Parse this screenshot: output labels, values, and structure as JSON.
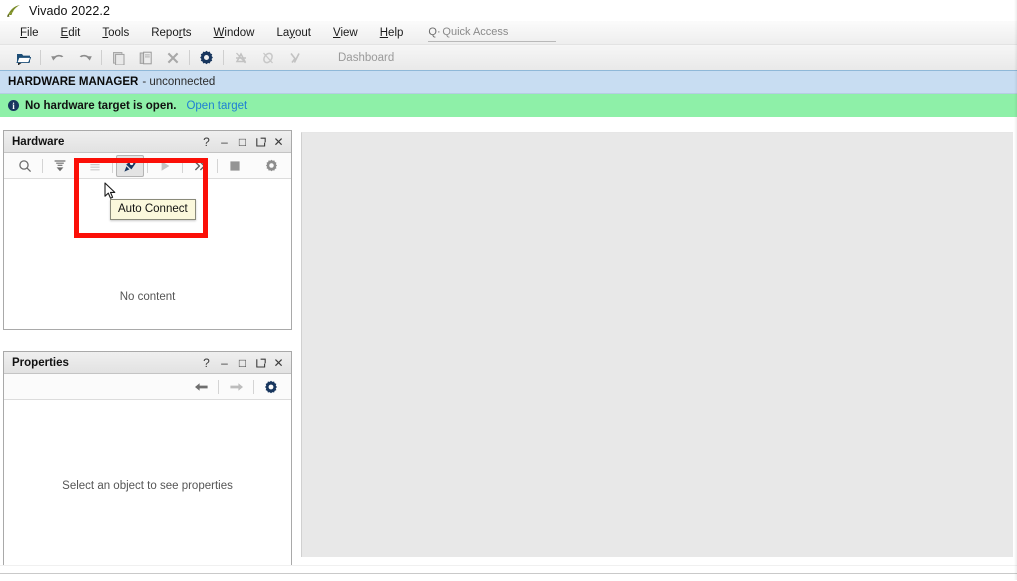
{
  "window": {
    "title": "Vivado 2022.2",
    "logo_icon": "vivado-leaf-icon"
  },
  "menubar": {
    "items": [
      {
        "label": "File",
        "mnemonic_index": 0
      },
      {
        "label": "Edit",
        "mnemonic_index": 0
      },
      {
        "label": "Tools",
        "mnemonic_index": 0
      },
      {
        "label": "Reports",
        "mnemonic_index": 4
      },
      {
        "label": "Window",
        "mnemonic_index": 0
      },
      {
        "label": "Layout",
        "mnemonic_index": 2
      },
      {
        "label": "View",
        "mnemonic_index": 0
      },
      {
        "label": "Help",
        "mnemonic_index": 0
      }
    ],
    "quick_access": {
      "prefix": "Q·",
      "placeholder": "Quick Access",
      "value": ""
    }
  },
  "toolbar": {
    "buttons": [
      {
        "name": "open-project-icon",
        "title": "Open Project",
        "enabled": true
      },
      {
        "name": "undo-icon",
        "title": "Undo",
        "enabled": true
      },
      {
        "name": "redo-icon",
        "title": "Redo",
        "enabled": true
      },
      {
        "name": "copy-icon",
        "title": "Copy",
        "enabled": false
      },
      {
        "name": "paste-icon",
        "title": "Paste",
        "enabled": false
      },
      {
        "name": "close-x-icon",
        "title": "Delete",
        "enabled": false
      },
      {
        "name": "settings-gear-icon",
        "title": "Settings",
        "enabled": true
      },
      {
        "name": "run-synthesis-icon",
        "title": "Run Synthesis",
        "enabled": false
      },
      {
        "name": "run-implementation-icon",
        "title": "Run Implementation",
        "enabled": false
      },
      {
        "name": "generate-bitstream-icon",
        "title": "Generate Bitstream",
        "enabled": false
      }
    ],
    "dashboard_label": "Dashboard"
  },
  "hardware_manager": {
    "title": "HARDWARE MANAGER",
    "status": "- unconnected"
  },
  "notification": {
    "icon": "info-icon",
    "icon_glyph": "i",
    "message": "No hardware target is open.",
    "link_label": "Open target",
    "background": "#8ef0a8",
    "link_color": "#1f7fd4"
  },
  "hardware_panel": {
    "title": "Hardware",
    "empty_message": "No content",
    "header_buttons": [
      {
        "name": "help-button",
        "glyph": "?"
      },
      {
        "name": "minimize-button",
        "glyph": "–"
      },
      {
        "name": "maximize-button",
        "glyph": "□"
      },
      {
        "name": "float-button",
        "glyph": "↗"
      },
      {
        "name": "close-button",
        "glyph": "✕"
      }
    ],
    "tools": [
      {
        "name": "search-icon",
        "title": "Search",
        "enabled": true,
        "hovered": false
      },
      {
        "name": "collapse-all-icon",
        "title": "Collapse All",
        "enabled": true,
        "hovered": false
      },
      {
        "name": "expand-all-icon",
        "title": "Expand All",
        "enabled": false,
        "hovered": false
      },
      {
        "name": "auto-connect-icon",
        "title": "Auto Connect",
        "enabled": true,
        "hovered": true
      },
      {
        "name": "run-trigger-icon",
        "title": "Run Trigger",
        "enabled": false,
        "hovered": false
      },
      {
        "name": "more-options-icon",
        "title": "More Options",
        "enabled": true,
        "hovered": false
      },
      {
        "name": "stop-icon",
        "title": "Stop",
        "enabled": true,
        "hovered": false
      },
      {
        "name": "settings-gear-icon",
        "title": "Settings",
        "enabled": true,
        "hovered": false
      }
    ]
  },
  "properties_panel": {
    "title": "Properties",
    "empty_message": "Select an object to see properties",
    "header_buttons": [
      {
        "name": "help-button",
        "glyph": "?"
      },
      {
        "name": "minimize-button",
        "glyph": "–"
      },
      {
        "name": "maximize-button",
        "glyph": "□"
      },
      {
        "name": "float-button",
        "glyph": "↗"
      },
      {
        "name": "close-button",
        "glyph": "✕"
      }
    ],
    "tools": [
      {
        "name": "back-arrow-icon",
        "title": "Back",
        "enabled": true
      },
      {
        "name": "forward-arrow-icon",
        "title": "Forward",
        "enabled": false
      },
      {
        "name": "settings-gear-icon",
        "title": "Settings",
        "enabled": true
      }
    ]
  },
  "tooltip": {
    "text": "Auto Connect",
    "background": "#fbf8dc"
  },
  "highlight": {
    "name": "auto-connect-highlight",
    "color": "#fb0f07"
  },
  "cursor": {
    "name": "mouse-pointer"
  }
}
